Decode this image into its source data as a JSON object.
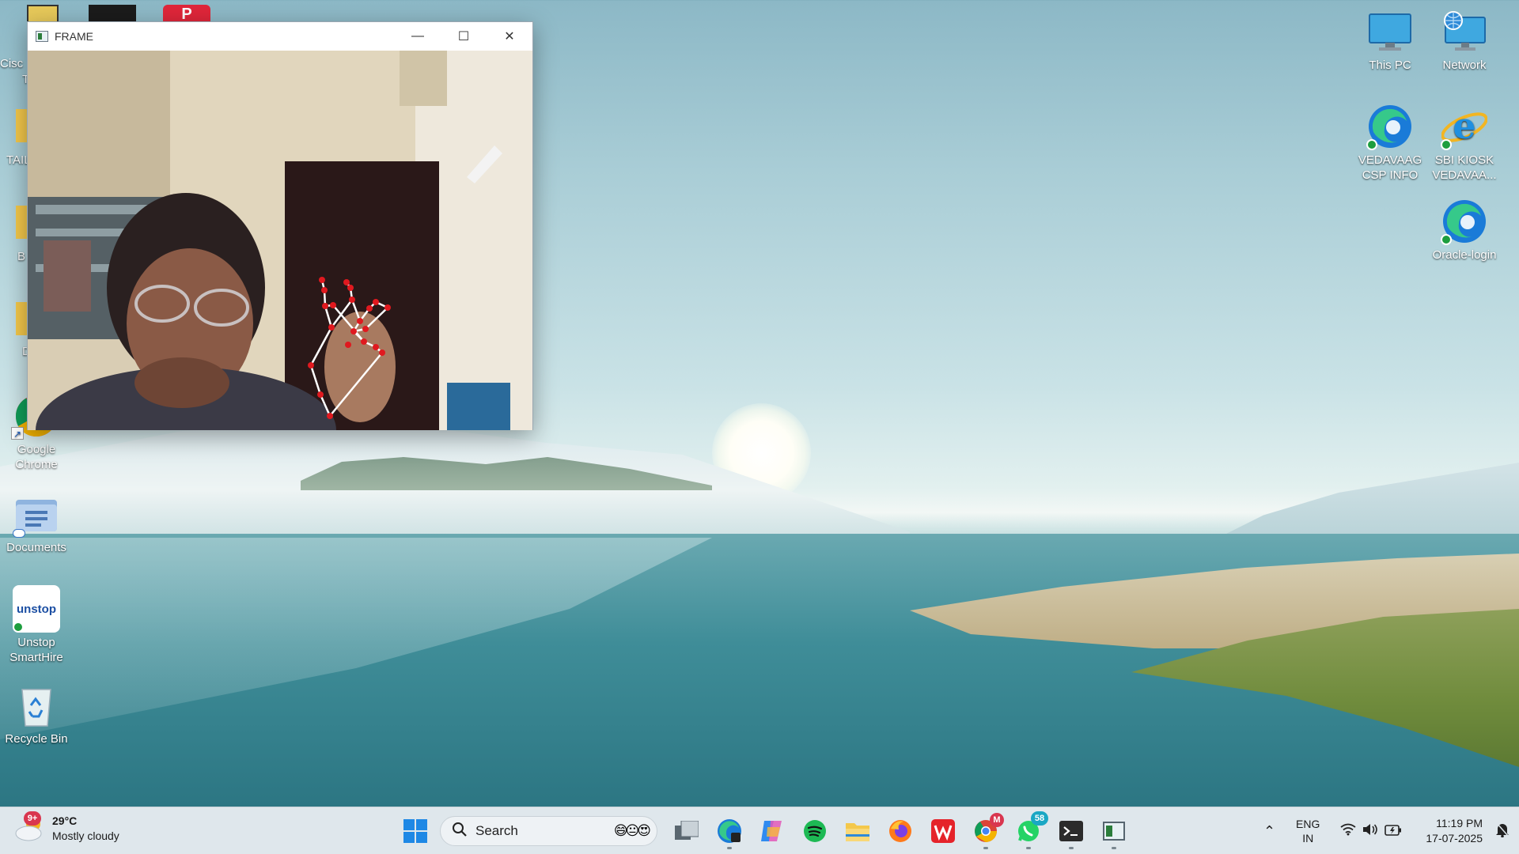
{
  "desktop": {
    "left_icons": [
      {
        "label": "Google Chrome"
      },
      {
        "label": "Documents"
      },
      {
        "label": "Unstop SmartHire",
        "logo_text": "unstop"
      },
      {
        "label": "Recycle Bin"
      }
    ],
    "left_partial_labels": [
      "Cisc",
      "T",
      "TAIL",
      "B",
      "D"
    ],
    "right_icons": [
      {
        "label": "This PC"
      },
      {
        "label": "Network"
      },
      {
        "label": "VEDAVAAG CSP INFO"
      },
      {
        "label": "SBI KIOSK VEDAVAA..."
      },
      {
        "label": "Oracle-login"
      }
    ]
  },
  "camera_window": {
    "title": "FRAME",
    "controls": {
      "minimize": "—",
      "maximize": "☐",
      "close": "✕"
    },
    "landmark_color": "#e0191f",
    "connection_color": "#ffffff"
  },
  "taskbar": {
    "weather": {
      "badge": "9+",
      "temperature": "29°C",
      "condition": "Mostly cloudy"
    },
    "search": {
      "label": "Search",
      "emojis": "😄😐😍"
    },
    "apps": [
      {
        "name": "task-view"
      },
      {
        "name": "edge-beta"
      },
      {
        "name": "copilot"
      },
      {
        "name": "spotify"
      },
      {
        "name": "file-explorer"
      },
      {
        "name": "firefox"
      },
      {
        "name": "wps-office"
      },
      {
        "name": "chrome",
        "badge": "M"
      },
      {
        "name": "whatsapp",
        "badge": "58"
      },
      {
        "name": "terminal"
      },
      {
        "name": "python-frame"
      }
    ],
    "tray": {
      "language_line1": "ENG",
      "language_line2": "IN",
      "time": "11:19 PM",
      "date": "17-07-2025"
    }
  },
  "colors": {
    "taskbar_bg": "#dfe7ec",
    "accent_windows": "#1e88e5",
    "sync_green": "#1d9e3e"
  }
}
